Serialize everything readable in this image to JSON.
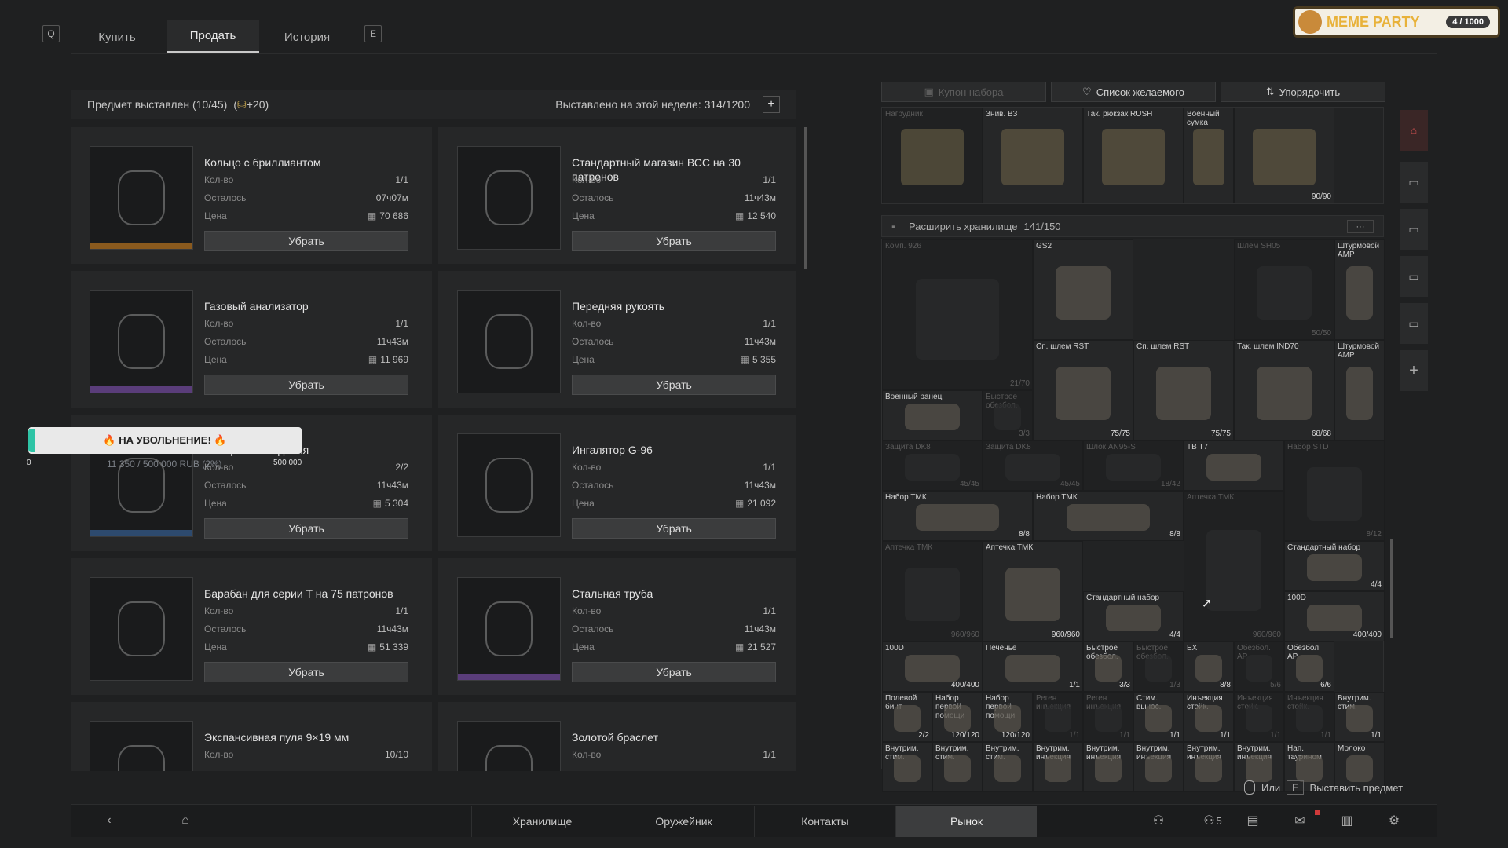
{
  "topbar": {
    "key_left": "Q",
    "key_right": "E",
    "tabs": [
      {
        "label": "Купить"
      },
      {
        "label": "Продать",
        "active": true
      },
      {
        "label": "История"
      }
    ]
  },
  "party": {
    "title": "MEME PARTY",
    "count": "4 / 1000"
  },
  "listing": {
    "listed_label": "Предмет выставлен (10/45)",
    "bonus": "+20",
    "week_label": "Выставлено на этой неделе: 314/1200",
    "field_qty": "Кол-во",
    "field_left": "Осталось",
    "field_price": "Цена",
    "remove_label": "Убрать",
    "items": [
      {
        "name": "Кольцо с бриллиантом",
        "qty": "1/1",
        "left": "07ч07м",
        "price": "70 686",
        "rarity": "#8a5a1e",
        "icon": "ring-icon"
      },
      {
        "name": "Стандартный магазин ВСС на 30 патронов",
        "qty": "1/1",
        "left": "11ч43м",
        "price": "12 540",
        "rarity": "",
        "icon": "magazine-icon"
      },
      {
        "name": "Газовый анализатор",
        "qty": "1/1",
        "left": "11ч43м",
        "price": "11 969",
        "rarity": "#5a3d7a",
        "icon": "gas-analyzer-icon"
      },
      {
        "name": "Передняя рукоять",
        "qty": "1/1",
        "left": "11ч43м",
        "price": "5 355",
        "rarity": "",
        "icon": "foregrip-icon"
      },
      {
        "name": "Камера наблюдения",
        "qty": "2/2",
        "left": "11ч43м",
        "price": "5 304",
        "rarity": "#2d4a6e",
        "icon": "camera-icon"
      },
      {
        "name": "Ингалятор G-96",
        "qty": "1/1",
        "left": "11ч43м",
        "price": "21 092",
        "rarity": "",
        "icon": "inhaler-icon"
      },
      {
        "name": "Барабан для серии T на 75 патронов",
        "qty": "1/1",
        "left": "11ч43м",
        "price": "51 339",
        "rarity": "",
        "icon": "drum-icon"
      },
      {
        "name": "Стальная труба",
        "qty": "1/1",
        "left": "11ч43м",
        "price": "21 527",
        "rarity": "#5a3d7a",
        "icon": "pipe-icon"
      },
      {
        "name": "Экспансивная пуля 9×19 мм",
        "qty": "10/10",
        "left": "",
        "price": "",
        "rarity": "",
        "icon": "bullet-icon"
      },
      {
        "name": "Золотой браслет",
        "qty": "1/1",
        "left": "",
        "price": "",
        "rarity": "",
        "icon": "bracelet-icon"
      }
    ]
  },
  "promo": {
    "label": "🔥 НА УВОЛЬНЕНИЕ! 🔥",
    "progress_text": "11 350 / 500 000 RUB (2%)",
    "min": "0",
    "max": "500 000",
    "progress": 0.02
  },
  "stash": {
    "coupon_label": "Купон набора",
    "wishlist_label": "Список желаемого",
    "sort_label": "Упорядочить",
    "expand_label": "Расширить хранилище",
    "capacity": "141/150",
    "more": "···",
    "top_row": [
      {
        "label": "Нагрудник",
        "count": ""
      },
      {
        "label": "Знив. ВЗ",
        "count": ""
      },
      {
        "label": "Так. рюкзак RUSH",
        "count": ""
      },
      {
        "label": "Военный сумка",
        "count": ""
      },
      {
        "label": "",
        "count": "90/90"
      }
    ],
    "cells": [
      {
        "label": "Комп. 926",
        "count": "21/70",
        "dim": true
      },
      {
        "label": "GS2",
        "count": "",
        "dim": false
      },
      {
        "label": "Шлем SH05",
        "count": "50/50",
        "dim": true
      },
      {
        "label": "Штурмовой АМР",
        "count": "",
        "dim": false
      },
      {
        "label": "Сп. шлем RST",
        "count": "75/75",
        "dim": false
      },
      {
        "label": "Сп. шлем RST",
        "count": "75/75",
        "dim": false
      },
      {
        "label": "Так. шлем IND70",
        "count": "68/68",
        "dim": false
      },
      {
        "label": "Штурмовой АМР",
        "count": "",
        "dim": false
      },
      {
        "label": "Военный ранец",
        "count": "",
        "dim": false
      },
      {
        "label": "Быстрое обезбол.",
        "count": "3/3",
        "dim": true
      },
      {
        "label": "Защита DK8",
        "count": "45/45",
        "dim": true
      },
      {
        "label": "Защита DK8",
        "count": "45/45",
        "dim": true
      },
      {
        "label": "Шлок AN95-S",
        "count": "18/42",
        "dim": true
      },
      {
        "label": "TB T7",
        "count": "",
        "dim": false
      },
      {
        "label": "Набор STD",
        "count": "8/12",
        "dim": true
      },
      {
        "label": "Набор ТМК",
        "count": "8/8",
        "dim": false
      },
      {
        "label": "Набор ТМК",
        "count": "8/8",
        "dim": false
      },
      {
        "label": "Аптечка ТМК",
        "count": "960/960",
        "dim": true
      },
      {
        "label": "Аптечка ТМК",
        "count": "960/960",
        "dim": true
      },
      {
        "label": "Аптечка ТМК",
        "count": "960/960",
        "dim": false
      },
      {
        "label": "Стандартный набор",
        "count": "4/4",
        "dim": false
      },
      {
        "label": "Стандартный набор",
        "count": "4/4",
        "dim": false
      },
      {
        "label": "100D",
        "count": "400/400",
        "dim": false
      },
      {
        "label": "100D",
        "count": "400/400",
        "dim": false
      },
      {
        "label": "Печенье",
        "count": "1/1",
        "dim": false
      },
      {
        "label": "Быстрое обезбол.",
        "count": "3/3",
        "dim": false
      },
      {
        "label": "Быстрое обезбол.",
        "count": "1/3",
        "dim": true
      },
      {
        "label": "EX",
        "count": "8/8",
        "dim": false
      },
      {
        "label": "Обезбол. АР",
        "count": "5/6",
        "dim": true
      },
      {
        "label": "Обезбол. АР",
        "count": "6/6",
        "dim": false
      },
      {
        "label": "Полевой бинт",
        "count": "2/2",
        "dim": false
      },
      {
        "label": "Набор первой помощи",
        "count": "120/120",
        "dim": false
      },
      {
        "label": "Набор первой помощи",
        "count": "120/120",
        "dim": false
      },
      {
        "label": "Реген инъекция",
        "count": "1/1",
        "dim": true
      },
      {
        "label": "Реген инъекция",
        "count": "1/1",
        "dim": true
      },
      {
        "label": "Стим. вынос.",
        "count": "1/1",
        "dim": false
      },
      {
        "label": "Инъекция стойк.",
        "count": "1/1",
        "dim": false
      },
      {
        "label": "Инъекция стойк.",
        "count": "1/1",
        "dim": true
      },
      {
        "label": "Инъекция стойк.",
        "count": "1/1",
        "dim": true
      },
      {
        "label": "Внутрим. стим.",
        "count": "1/1",
        "dim": false
      },
      {
        "label": "Внутрим. стим.",
        "count": "",
        "dim": false
      },
      {
        "label": "Внутрим. стим.",
        "count": "",
        "dim": false
      },
      {
        "label": "Внутрим. стим.",
        "count": "",
        "dim": false
      },
      {
        "label": "Внутрим. инъекция",
        "count": "",
        "dim": false
      },
      {
        "label": "Внутрим. инъекция",
        "count": "",
        "dim": false
      },
      {
        "label": "Внутрим. инъекция",
        "count": "",
        "dim": false
      },
      {
        "label": "Внутрим. инъекция",
        "count": "",
        "dim": false
      },
      {
        "label": "Внутрим. инъекция",
        "count": "",
        "dim": false
      },
      {
        "label": "Нап. таурином",
        "count": "",
        "dim": false
      },
      {
        "label": "Молоко",
        "count": "",
        "dim": false
      }
    ]
  },
  "place_hint": {
    "or": "Или",
    "key": "F",
    "label": "Выставить предмет"
  },
  "bottom": {
    "tabs": [
      {
        "label": "Хранилище"
      },
      {
        "label": "Оружейник"
      },
      {
        "label": "Контакты"
      },
      {
        "label": "Рынок",
        "active": true
      }
    ],
    "friends_count": "5"
  }
}
